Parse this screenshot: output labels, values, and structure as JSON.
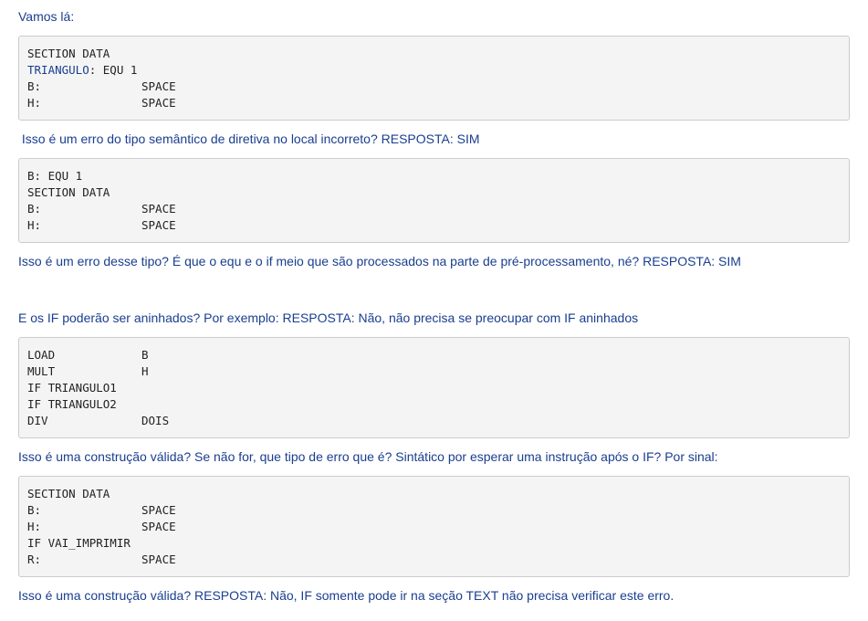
{
  "paragraphs": {
    "p1": "Vamos lá:",
    "p2": " Isso é um erro do tipo semântico de diretiva no local incorreto? RESPOSTA: SIM",
    "p3": "Isso é um erro desse tipo? É que o equ e o if meio que são processados na parte de pré-processamento, né? RESPOSTA: SIM",
    "p4": "E os IF poderão ser aninhados? Por exemplo: RESPOSTA: Não, não precisa se preocupar com IF aninhados",
    "p5": "Isso é uma construção válida? Se não for, que tipo de erro que é? Sintático por esperar uma instrução após o IF? Por sinal:",
    "p6": "Isso é uma construção válida? RESPOSTA: Não, IF somente pode ir na seção TEXT não precisa verificar este erro."
  },
  "code1": {
    "l1": "SECTION DATA",
    "l2_label": "TRIANGULO",
    "l2_rest": ": EQU 1",
    "l3_a": "B:",
    "l3_b": "SPACE",
    "l4_a": "H:",
    "l4_b": "SPACE"
  },
  "code2": {
    "l1": "B: EQU 1",
    "l2": "SECTION DATA",
    "l3_a": "B:",
    "l3_b": "SPACE",
    "l4_a": "H:",
    "l4_b": "SPACE"
  },
  "code3": {
    "l1_a": "LOAD",
    "l1_b": "B",
    "l2_a": "MULT",
    "l2_b": "H",
    "l3": "IF TRIANGULO1",
    "l4": "IF TRIANGULO2",
    "l5_a": "DIV",
    "l5_b": "DOIS"
  },
  "code4": {
    "l1": "SECTION DATA",
    "l2_a": "B:",
    "l2_b": "SPACE",
    "l3_a": "H:",
    "l3_b": "SPACE",
    "l4": "IF VAI_IMPRIMIR",
    "l5_a": "R:",
    "l5_b": "SPACE"
  }
}
